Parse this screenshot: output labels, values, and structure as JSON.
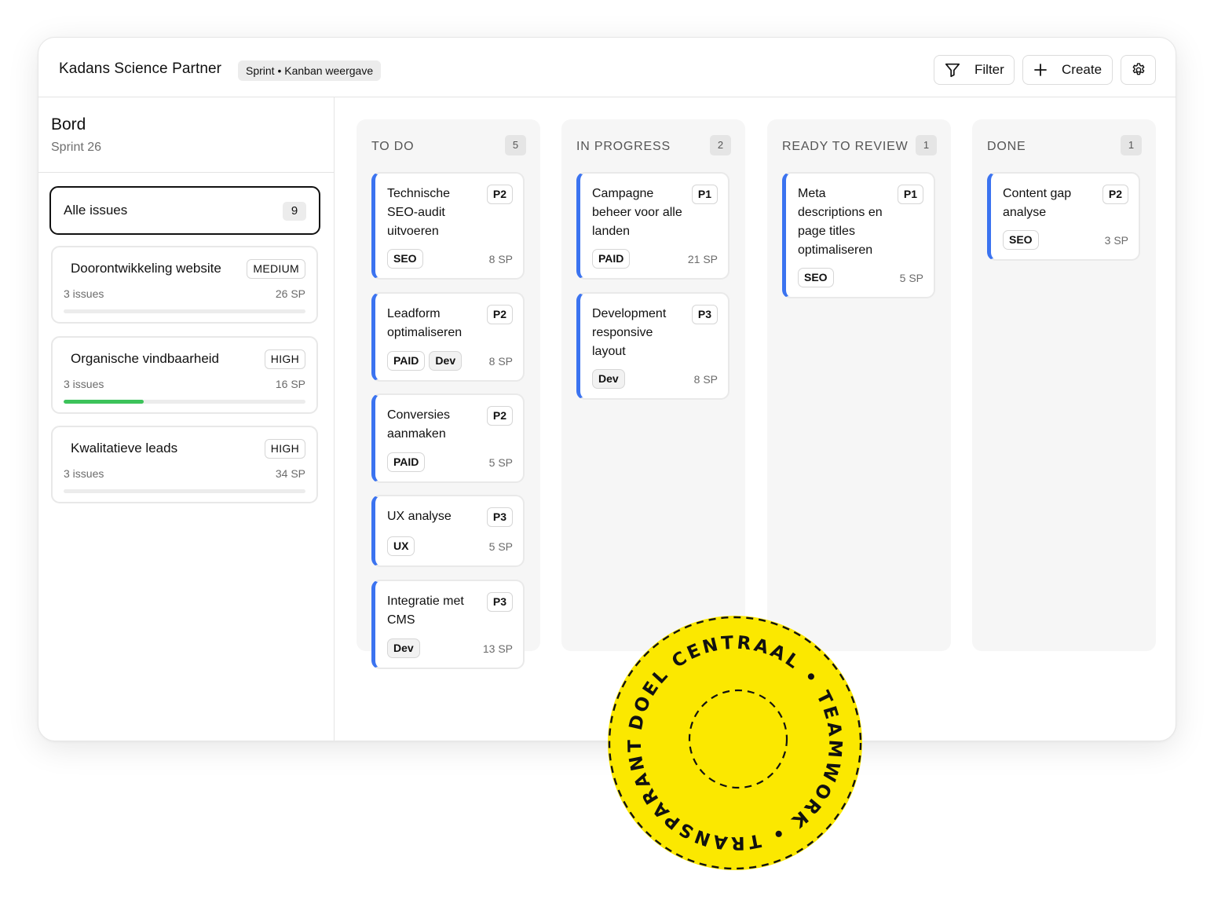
{
  "header": {
    "app_title": "Kadans Science Partner",
    "view_label": "Sprint • Kanban weergave",
    "filter_label": "Filter",
    "create_label": "Create",
    "filter_icon": "funnel-icon",
    "create_icon": "plus-icon",
    "settings_icon": "gear-icon"
  },
  "sidebar": {
    "title": "Bord",
    "subtitle": "Sprint 26",
    "all_issues": {
      "label": "Alle issues",
      "count": "9"
    },
    "epics": [
      {
        "name": "Doorontwikkeling website",
        "priority": "MEDIUM",
        "issues": "3 issues",
        "sp": "26 SP",
        "progress": 0
      },
      {
        "name": "Organische vindbaarheid",
        "priority": "HIGH",
        "issues": "3 issues",
        "sp": "16 SP",
        "progress": 0.33
      },
      {
        "name": "Kwalitatieve leads",
        "priority": "HIGH",
        "issues": "3 issues",
        "sp": "34 SP",
        "progress": 0
      }
    ],
    "progress_color": "#3cc35a"
  },
  "columns": [
    {
      "title": "TO DO",
      "count": "5",
      "cards": [
        {
          "title": "Technische SEO-audit uitvoeren",
          "priority": "P2",
          "tags": [
            "SEO"
          ],
          "sp": "8 SP"
        },
        {
          "title": "Leadform optimaliseren",
          "priority": "P2",
          "tags": [
            "PAID",
            "Dev"
          ],
          "sp": "8 SP"
        },
        {
          "title": "Conversies aanmaken",
          "priority": "P2",
          "tags": [
            "PAID"
          ],
          "sp": "5 SP"
        },
        {
          "title": "UX analyse",
          "priority": "P3",
          "tags": [
            "UX"
          ],
          "sp": "5 SP"
        },
        {
          "title": "Integratie met CMS",
          "priority": "P3",
          "tags": [
            "Dev"
          ],
          "sp": "13 SP"
        }
      ]
    },
    {
      "title": "IN PROGRESS",
      "count": "2",
      "cards": [
        {
          "title": "Campagne beheer voor alle landen",
          "priority": "P1",
          "tags": [
            "PAID"
          ],
          "sp": "21 SP"
        },
        {
          "title": "Development responsive layout",
          "priority": "P3",
          "tags": [
            "Dev"
          ],
          "sp": "8 SP"
        }
      ]
    },
    {
      "title": "READY TO REVIEW",
      "count": "1",
      "cards": [
        {
          "title": "Meta descriptions en page titles optimaliseren",
          "priority": "P1",
          "tags": [
            "SEO"
          ],
          "sp": "5 SP"
        }
      ]
    },
    {
      "title": "DONE",
      "count": "1",
      "cards": [
        {
          "title": "Content gap analyse",
          "priority": "P2",
          "tags": [
            "SEO"
          ],
          "sp": "3 SP"
        }
      ]
    }
  ],
  "accent_color": "#3b73f0",
  "seal": {
    "text": "DOEL CENTRAAL • TEAMWORK • TRANSPARANTIE •",
    "color": "#fbe800"
  }
}
